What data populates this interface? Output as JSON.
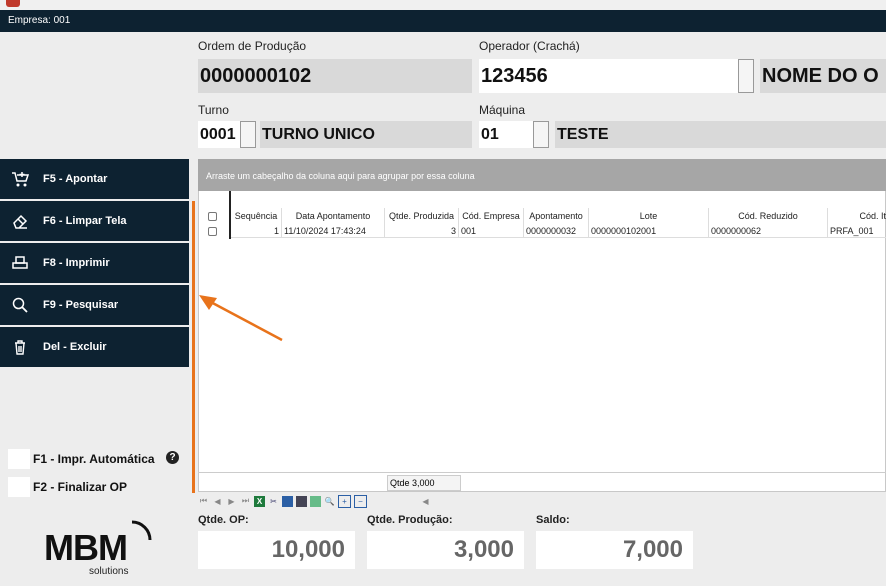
{
  "header": {
    "empresa": "Empresa: 001"
  },
  "form": {
    "ordem_label": "Ordem de Produção",
    "ordem_value": "0000000102",
    "operador_label": "Operador (Crachá)",
    "operador_value": "123456",
    "operador_nome": "NOME DO O",
    "turno_label": "Turno",
    "turno_code": "0001",
    "turno_nome": "TURNO UNICO",
    "maquina_label": "Máquina",
    "maquina_code": "01",
    "maquina_nome": "TESTE"
  },
  "sidebar": {
    "items": [
      {
        "label": "F5 - Apontar",
        "icon": "cart-icon"
      },
      {
        "label": "F6 - Limpar Tela",
        "icon": "eraser-icon"
      },
      {
        "label": "F8 - Imprimir",
        "icon": "printer-icon"
      },
      {
        "label": "F9 - Pesquisar",
        "icon": "search-icon"
      },
      {
        "label": "Del - Excluir",
        "icon": "trash-icon"
      }
    ],
    "f1_label": "F1 - Impr. Automática",
    "f2_label": "F2 - Finalizar OP",
    "logo_text": "MBM",
    "logo_sub": "solutions"
  },
  "grid": {
    "group_hint": "Arraste um cabeçalho da coluna aqui para agrupar por essa coluna",
    "columns": [
      "Sequência",
      "Data Apontamento",
      "Qtde. Produzida",
      "Cód. Empresa",
      "Apontamento",
      "Lote",
      "Cód. Reduzido",
      "Cód. It"
    ],
    "rows": [
      [
        "1",
        "11/10/2024 17:43:24",
        "3",
        "001",
        "0000000032",
        "0000000102001",
        "0000000062",
        "PRFA_001"
      ]
    ],
    "footer_total": "Qtde 3,000"
  },
  "summary": {
    "qtde_op_label": "Qtde. OP:",
    "qtde_op_value": "10,000",
    "qtde_producao_label": "Qtde. Produção:",
    "qtde_producao_value": "3,000",
    "saldo_label": "Saldo:",
    "saldo_value": "7,000"
  },
  "colors": {
    "dark": "#0d2231",
    "accent": "#e8731b",
    "field": "#d9d9d9"
  }
}
